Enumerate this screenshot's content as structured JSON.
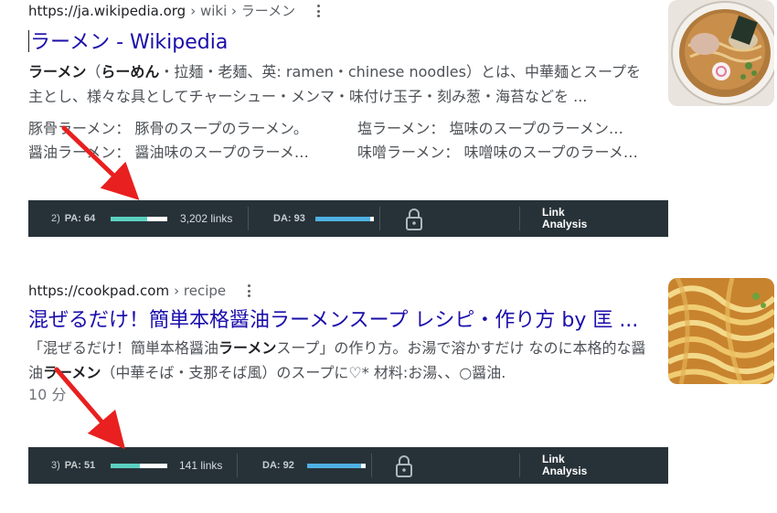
{
  "results": [
    {
      "url": "https://ja.wikipedia.org",
      "path": "› wiki › ラーメン",
      "title": "ラーメン - Wikipedia",
      "snippet_bold": "ラーメン",
      "snippet_bold2": "らーめん",
      "snippet_a": "（",
      "snippet_b": "・拉麺・老麺、英: ramen・chinese noodles）とは、中華麺とスープを主とし、様々な具としてチャーシュー・メンマ・味付け玉子・刻み葱・海苔などを ...",
      "sitelinks": [
        "豚骨ラーメン： 豚骨のスープのラーメン。",
        "塩ラーメン： 塩味のスープのラーメン…",
        "醤油ラーメン： 醤油味のスープのラーメ…",
        "味噌ラーメン： 味噌味のスープのラーメ…"
      ],
      "moz": {
        "rank": "2)",
        "pa_label": "PA: 64",
        "pa_value": 64,
        "links": "3,202 links",
        "da_label": "DA: 93",
        "da_value": 93,
        "link_analysis_1": "Link",
        "link_analysis_2": "Analysis"
      }
    },
    {
      "url": "https://cookpad.com",
      "path": "› recipe",
      "title": "混ぜるだけ！簡単本格醤油ラーメンスープ レシピ・作り方 by 匡 ...",
      "snippet_1": "「混ぜるだけ！簡単本格醤油",
      "snippet_bold1": "ラーメン",
      "snippet_2": "スープ」の作り方。お湯で溶かすだけ なのに本格的な醤油",
      "snippet_bold2": "ラーメン",
      "snippet_3": "（中華そば・支那そば風）のスープに♡* 材料:お湯、、○醤油.",
      "duration": "10 分",
      "moz": {
        "rank": "3)",
        "pa_label": "PA: 51",
        "pa_value": 51,
        "links": "141 links",
        "da_label": "DA: 92",
        "da_value": 92,
        "link_analysis_1": "Link",
        "link_analysis_2": "Analysis"
      }
    }
  ],
  "colors": {
    "title_link": "#1a0dab",
    "moz_bar_bg": "#273238",
    "pa_fill": "#5bd1c1",
    "da_fill": "#4fb1e3",
    "annotation_arrow": "#e8201f"
  },
  "icons": {
    "more": "kebab-menu-icon",
    "lock": "lock-icon",
    "arrow": "red-arrow-annotation"
  }
}
